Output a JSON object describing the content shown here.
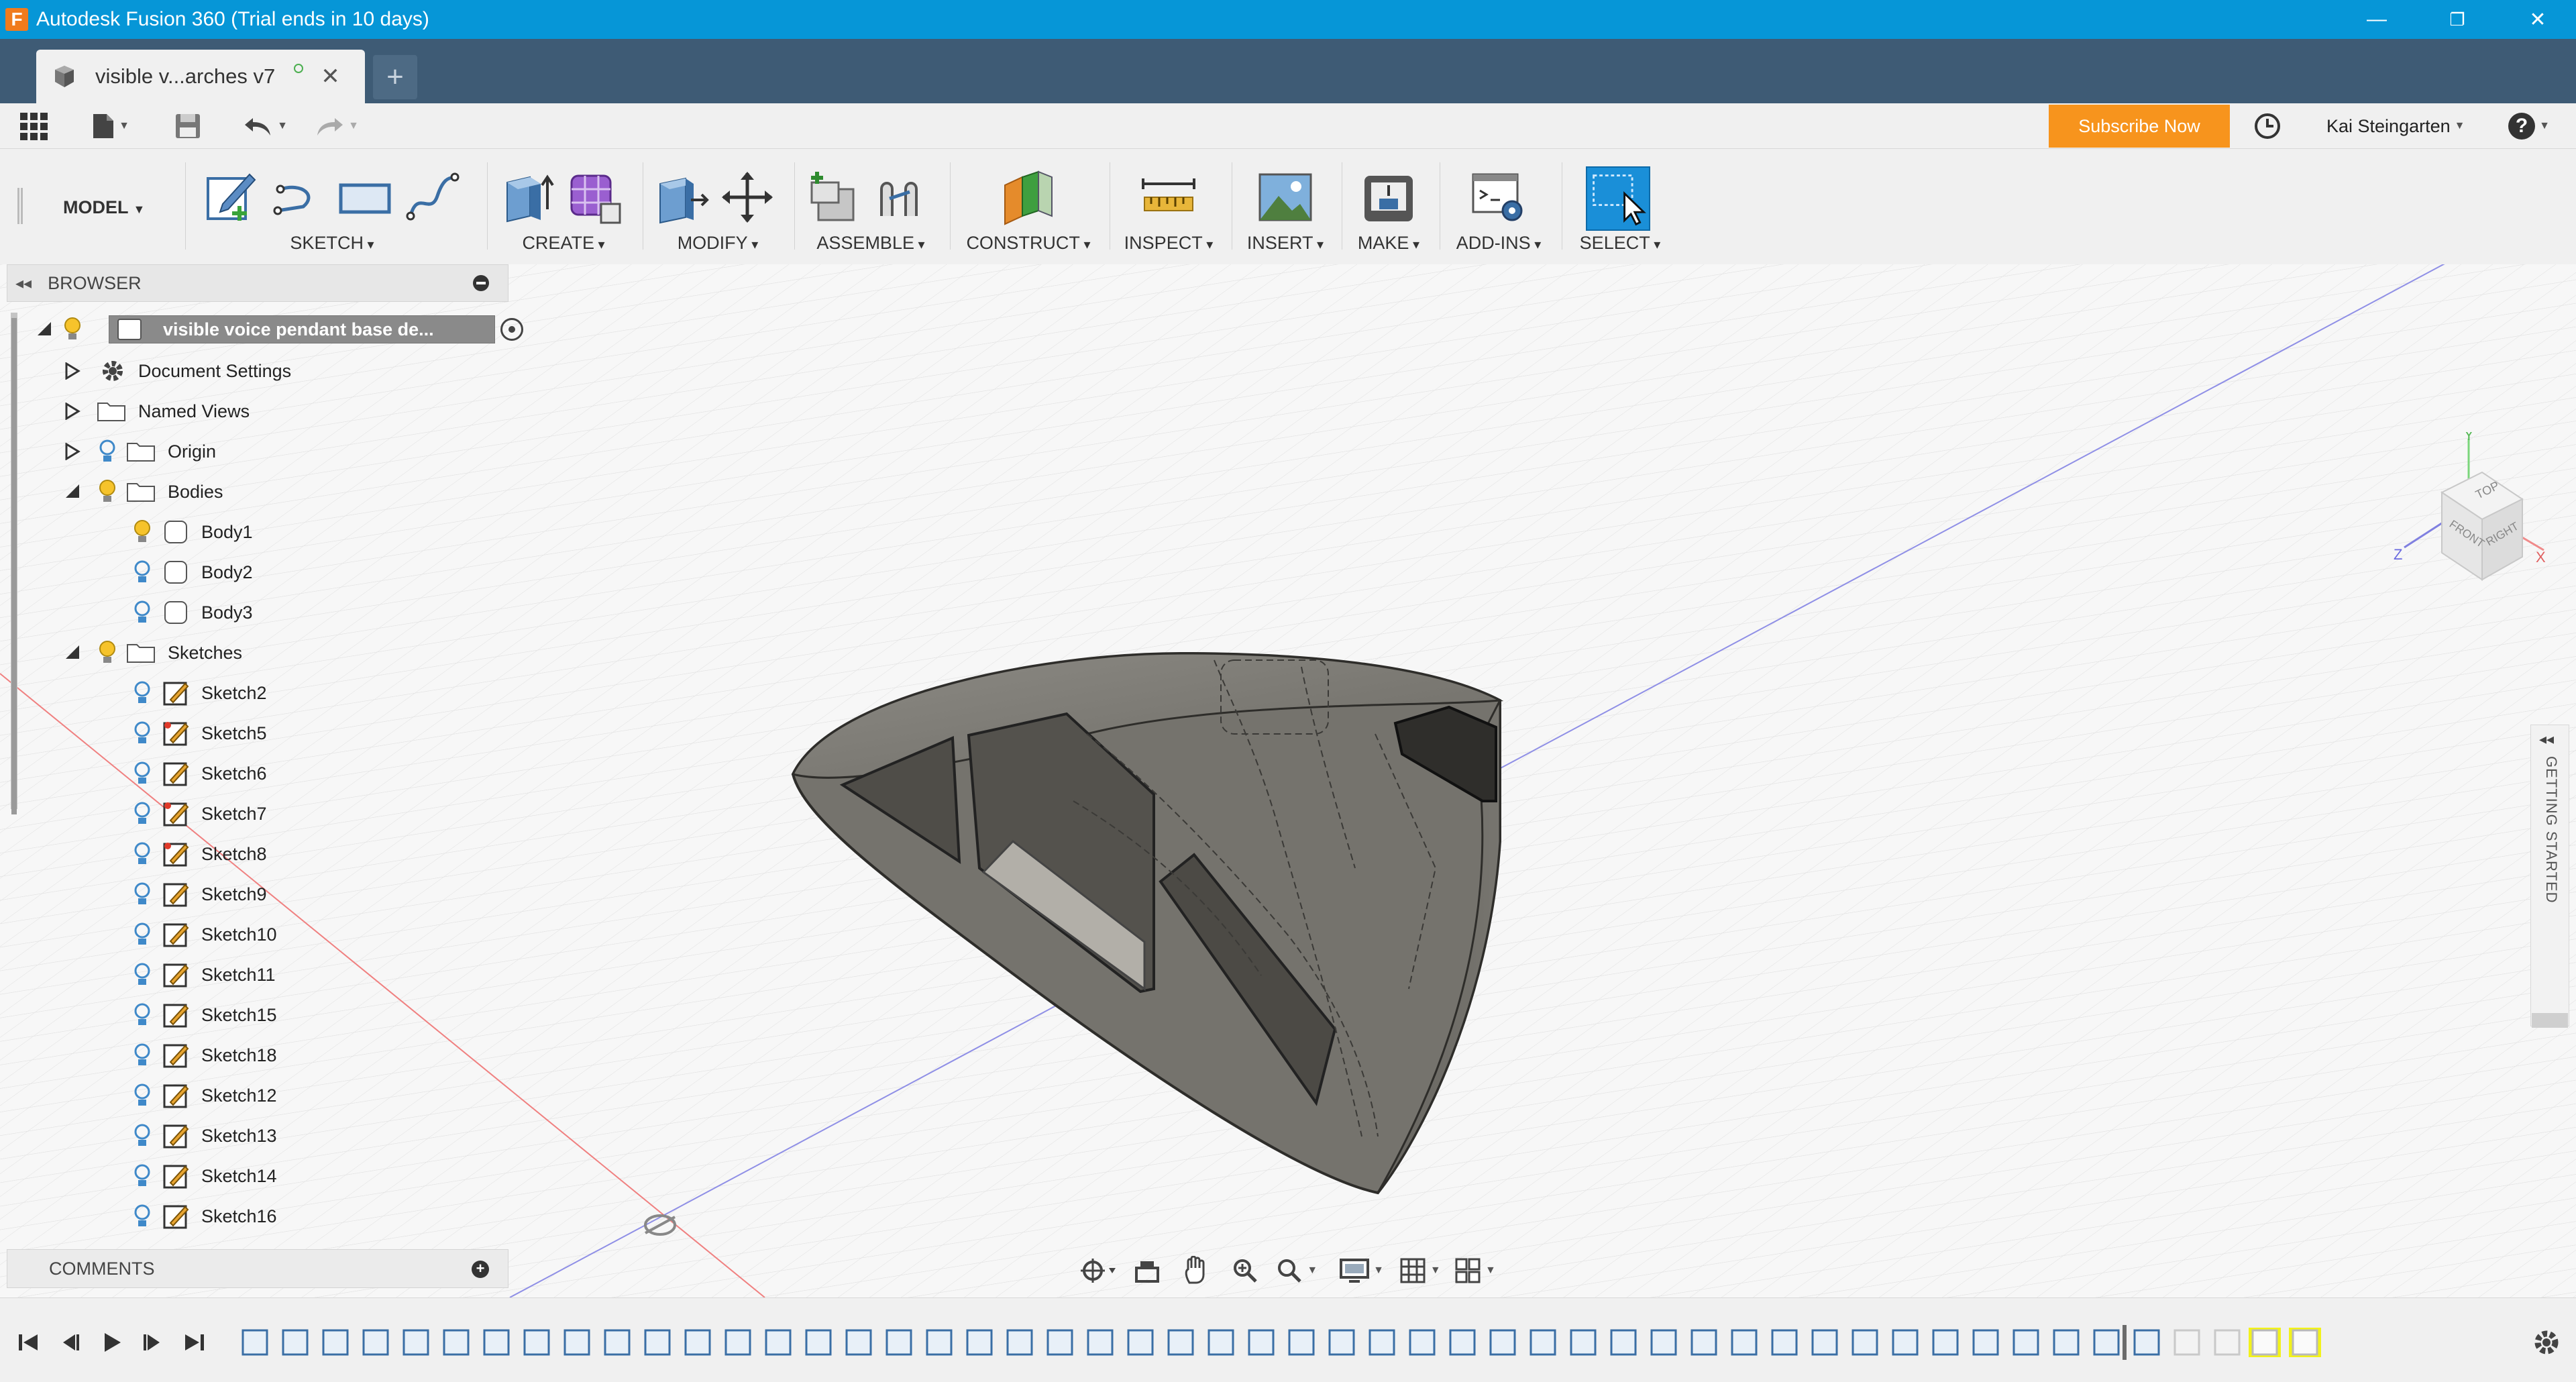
{
  "window": {
    "title": "Autodesk Fusion 360 (Trial ends in 10 days)",
    "logo_letter": "F",
    "controls": {
      "minimize": "—",
      "restore": "❐",
      "close": "✕"
    }
  },
  "tabs": {
    "document_tab_label": "visible v...arches v7",
    "close_glyph": "✕",
    "new_tab_glyph": "+"
  },
  "quick_access": {
    "subscribe_label": "Subscribe Now",
    "user_name": "Kai Steingarten",
    "help_glyph": "?"
  },
  "toolbar": {
    "workspace": "MODEL",
    "groups": {
      "sketch": "SKETCH",
      "create": "CREATE",
      "modify": "MODIFY",
      "assemble": "ASSEMBLE",
      "construct": "CONSTRUCT",
      "inspect": "INSPECT",
      "insert": "INSERT",
      "make": "MAKE",
      "addins": "ADD-INS",
      "select": "SELECT"
    }
  },
  "browser": {
    "title": "BROWSER",
    "root": "visible voice pendant base de...",
    "items": {
      "document_settings": "Document Settings",
      "named_views": "Named Views",
      "origin": "Origin",
      "bodies": "Bodies",
      "body1": "Body1",
      "body2": "Body2",
      "body3": "Body3",
      "sketches": "Sketches"
    },
    "sketches": [
      "Sketch2",
      "Sketch5",
      "Sketch6",
      "Sketch7",
      "Sketch8",
      "Sketch9",
      "Sketch10",
      "Sketch11",
      "Sketch15",
      "Sketch18",
      "Sketch12",
      "Sketch13",
      "Sketch14",
      "Sketch16"
    ]
  },
  "comments": {
    "title": "COMMENTS"
  },
  "viewcube": {
    "top": "TOP",
    "front": "FRONT",
    "right": "RIGHT",
    "x": "X",
    "y": "Y",
    "z": "Z"
  },
  "side_panel": {
    "label": "GETTING STARTED"
  },
  "colors": {
    "titlebar": "#0696d7",
    "tabbar": "#3e5b75",
    "subscribe": "#f7941d",
    "select_active": "#1a8fd8",
    "model_body": "#7a7770",
    "bulb_on": "#f6c32b"
  }
}
